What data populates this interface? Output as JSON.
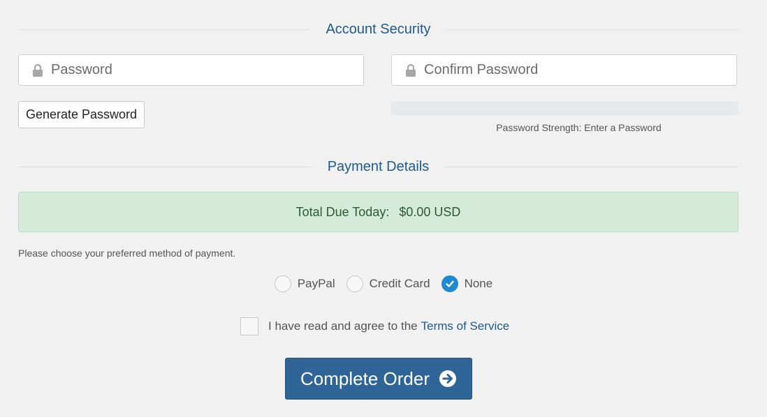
{
  "account_security": {
    "title": "Account Security",
    "password_placeholder": "Password",
    "confirm_placeholder": "Confirm Password",
    "generate_label": "Generate Password",
    "strength_text": "Password Strength: Enter a Password",
    "strength_level": 0
  },
  "payment_details": {
    "title": "Payment Details",
    "total_label": "Total Due Today:",
    "total_amount": "$0.00 USD",
    "choose_text": "Please choose your preferred method of payment.",
    "methods": [
      {
        "label": "PayPal",
        "selected": false
      },
      {
        "label": "Credit Card",
        "selected": false
      },
      {
        "label": "None",
        "selected": true
      }
    ]
  },
  "agreement": {
    "text": "I have read and agree to the",
    "link_text": "Terms of Service",
    "checked": false
  },
  "complete_button": {
    "label": "Complete Order"
  },
  "colors": {
    "accent": "#1e5b8c",
    "button": "#2f6497",
    "success_bg": "#d5ebd9",
    "radio_selected": "#1f8ad1"
  }
}
